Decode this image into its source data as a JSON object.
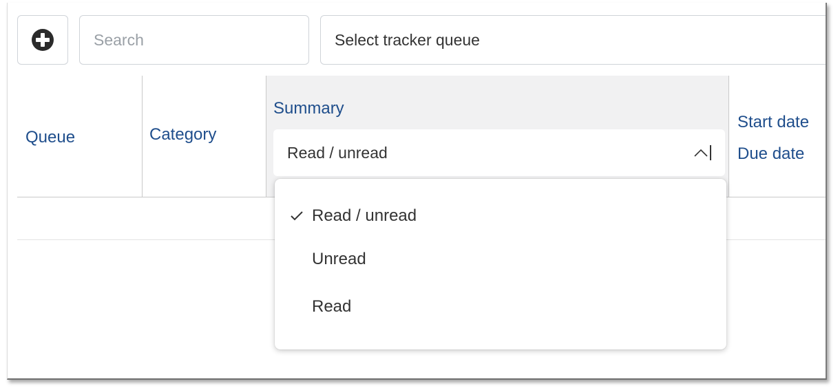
{
  "toolbar": {
    "add_icon": "plus-circle-icon",
    "search_placeholder": "Search",
    "queue_select_label": "Select tracker queue"
  },
  "table": {
    "columns": {
      "queue": "Queue",
      "category": "Category",
      "summary": "Summary",
      "start_date": "Start date",
      "due_date": "Due date"
    },
    "summary_filter": {
      "selected": "Read / unread",
      "caret_icon": "chevron-up-icon"
    }
  },
  "dropdown": {
    "options": [
      {
        "label": "Read / unread",
        "selected": true
      },
      {
        "label": "Unread",
        "selected": false
      },
      {
        "label": "Read",
        "selected": false
      }
    ],
    "check_icon": "checkmark-icon"
  },
  "colors": {
    "header_text": "#1f4e8c",
    "summary_header_bg": "#f1f1f2",
    "border": "#cfd3d8"
  }
}
